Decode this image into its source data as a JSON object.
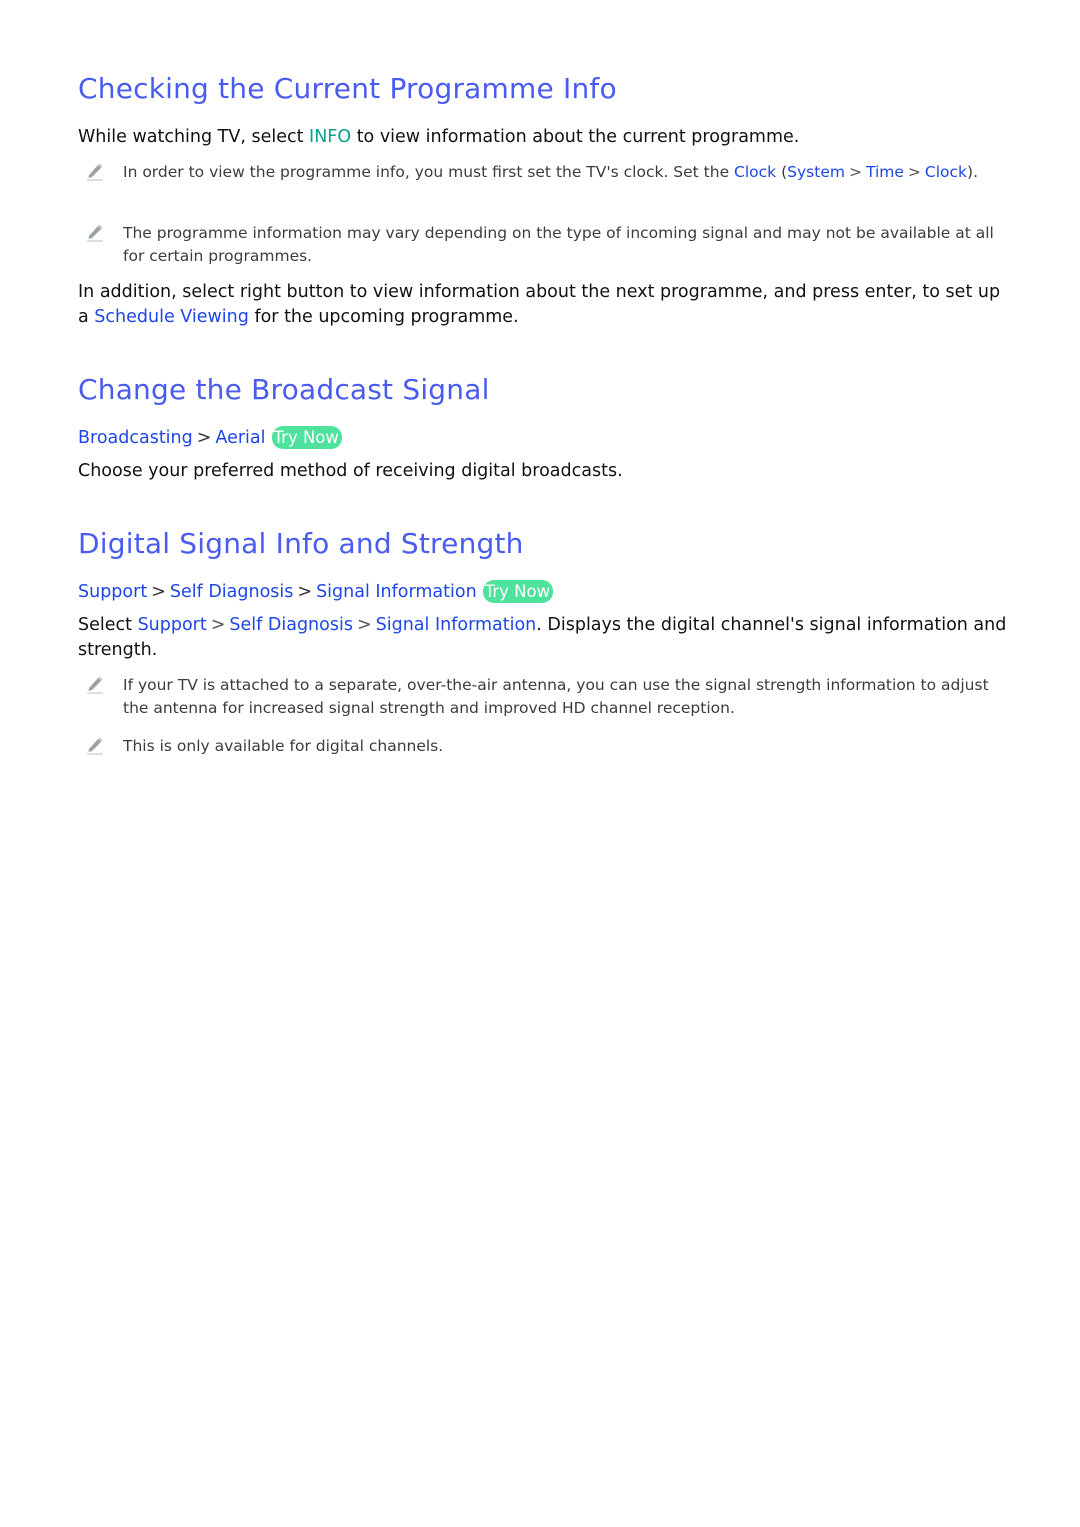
{
  "sections": [
    {
      "title": "Checking the Current Programme Info",
      "intro": {
        "pre": "While watching TV, select ",
        "highlight": "INFO",
        "post": " to view information about the current programme."
      },
      "notes": [
        {
          "pre": "In order to view the programme info, you must first set the TV's clock. Set the ",
          "link1": "Clock",
          "mid": " (",
          "link2": "System",
          "sep": ">",
          "link3": "Time",
          "link4": "Clock",
          "post": ")."
        },
        {
          "text": "The programme information may vary depending on the type of incoming signal and may not be available at all for certain programmes."
        }
      ],
      "outro": {
        "pre": "In addition, select right button to view information about the next programme, and press enter, to set up a ",
        "link": "Schedule Viewing",
        "post": " for the upcoming programme."
      }
    },
    {
      "title": "Change the Broadcast Signal",
      "path": [
        "Broadcasting",
        "Aerial"
      ],
      "try_now": "Try Now",
      "body": "Choose your preferred method of receiving digital broadcasts."
    },
    {
      "title": "Digital Signal Info and Strength",
      "path": [
        "Support",
        "Self Diagnosis",
        "Signal Information"
      ],
      "try_now": "Try Now",
      "body": {
        "pre": "Select ",
        "links": [
          "Support",
          "Self Diagnosis",
          "Signal Information"
        ],
        "post": ". Displays the digital channel's signal information and strength."
      },
      "notes": [
        {
          "text": "If your TV is attached to a separate, over-the-air antenna, you can use the signal strength information to adjust the antenna for increased signal strength and improved HD channel reception."
        },
        {
          "text": "This is only available for digital channels."
        }
      ]
    }
  ],
  "separator": ">",
  "colors": {
    "heading": "#4a5cf0",
    "link": "#1e46e6",
    "highlight": "#0aa08c",
    "try_now_bg": "#4fe29c",
    "note_text": "#3c3c3c"
  }
}
